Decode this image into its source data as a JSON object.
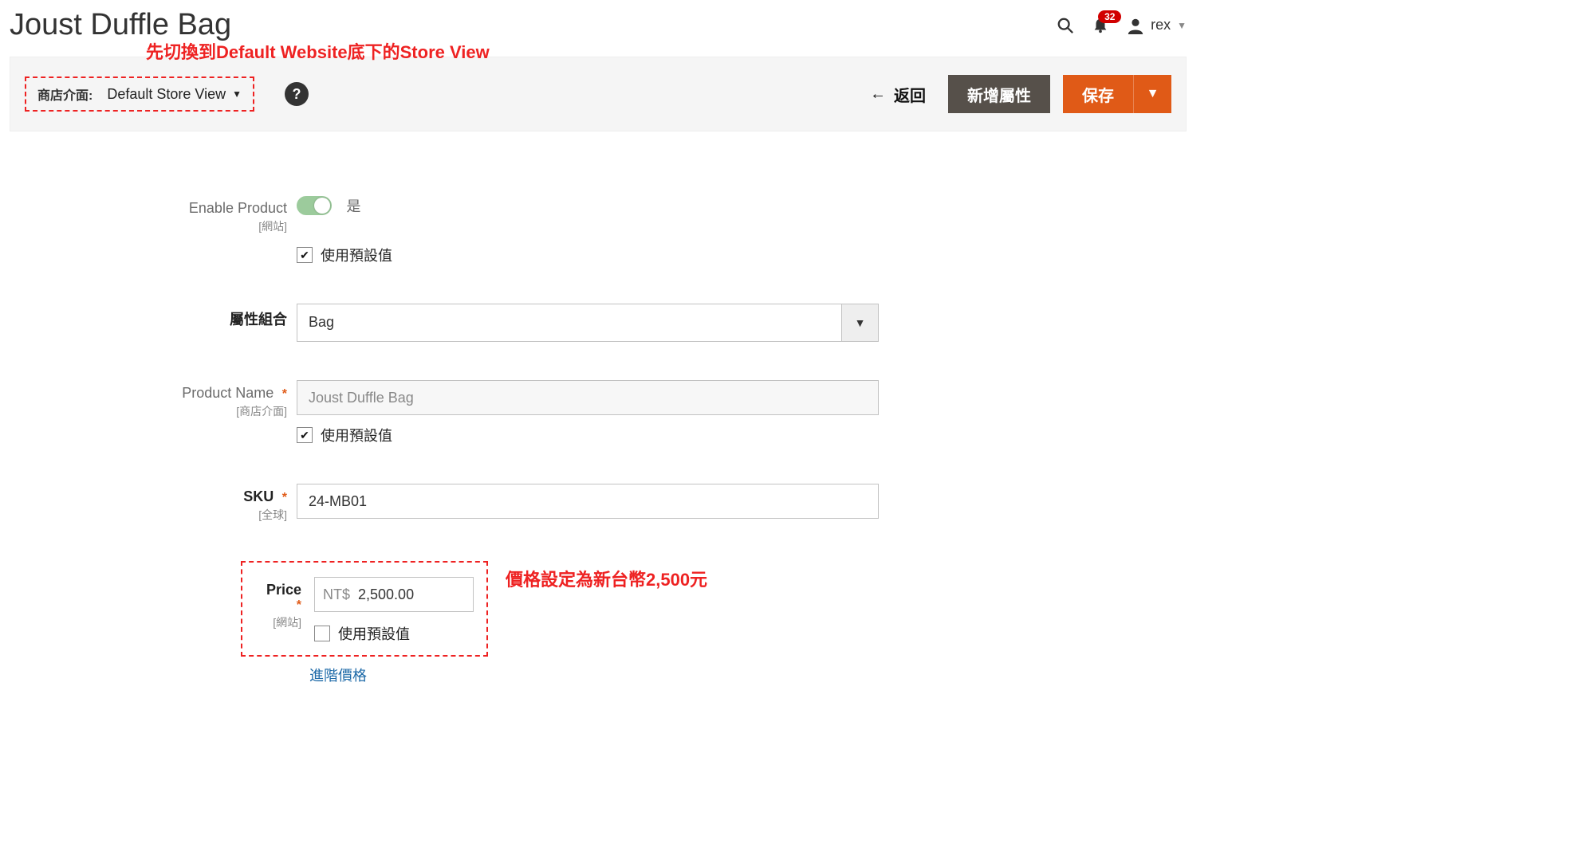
{
  "header": {
    "title": "Joust Duffle Bag",
    "notifications_count": "32",
    "user_name": "rex"
  },
  "toolbar": {
    "annotation_top": "先切換到Default Website底下的Store View",
    "scope_label": "商店介面:",
    "scope_value": "Default Store View",
    "back_label": "返回",
    "add_attr_label": "新增屬性",
    "save_label": "保存"
  },
  "form": {
    "enable": {
      "label": "Enable Product",
      "scope": "[網站]",
      "value_text": "是",
      "use_default": "使用預設值"
    },
    "attribute_set": {
      "label": "屬性組合",
      "value": "Bag"
    },
    "product_name": {
      "label": "Product Name",
      "scope": "[商店介面]",
      "value": "Joust Duffle Bag",
      "use_default": "使用預設值"
    },
    "sku": {
      "label": "SKU",
      "scope": "[全球]",
      "value": "24-MB01"
    },
    "price": {
      "label": "Price",
      "scope": "[網站]",
      "currency": "NT$",
      "value": "2,500.00",
      "use_default": "使用預設值",
      "advanced_link": "進階價格",
      "annotation": "價格設定為新台幣2,500元"
    }
  }
}
